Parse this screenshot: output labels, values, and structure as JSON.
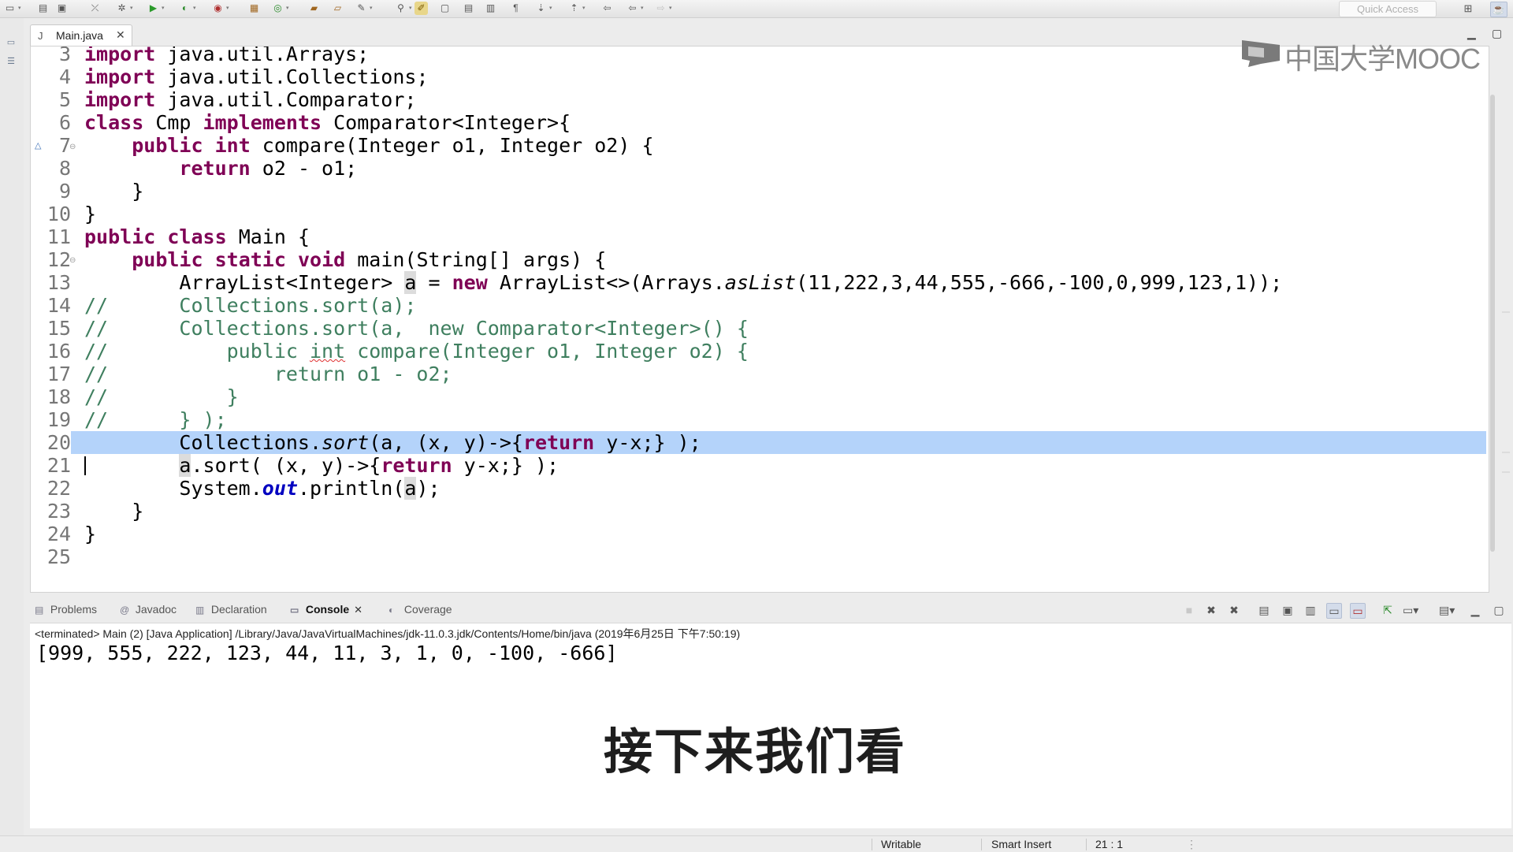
{
  "toolbar": {
    "icons": [
      "new-icon",
      "save-icon",
      "print-icon",
      "skip-breakpoints-icon",
      "debug-icon",
      "run-icon",
      "coverage-icon",
      "external-tools-icon",
      "new-java-project-icon",
      "new-package-icon",
      "new-class-icon",
      "open-type-icon",
      "open-task-icon",
      "search-icon",
      "toggle-mark-occurrences-icon",
      "highlight-icon",
      "block-selection-icon",
      "show-whitespace-icon",
      "next-annotation-icon",
      "prev-annotation-icon",
      "last-edit-icon",
      "back-icon",
      "forward-icon"
    ],
    "quick_access_placeholder": "Quick Access"
  },
  "editor": {
    "tab_label": "Main.java",
    "lines": [
      {
        "num": "3",
        "segments": [
          {
            "t": "import",
            "c": "kw"
          },
          {
            "t": " java.util.Arrays;"
          }
        ]
      },
      {
        "num": "4",
        "segments": [
          {
            "t": "import",
            "c": "kw"
          },
          {
            "t": " java.util.Collections;"
          }
        ]
      },
      {
        "num": "5",
        "segments": [
          {
            "t": "import",
            "c": "kw"
          },
          {
            "t": " java.util.Comparator;"
          }
        ]
      },
      {
        "num": "6",
        "segments": [
          {
            "t": "class",
            "c": "kw"
          },
          {
            "t": " Cmp "
          },
          {
            "t": "implements",
            "c": "kw"
          },
          {
            "t": " Comparator<Integer>{"
          }
        ]
      },
      {
        "num": "7",
        "segments": [
          {
            "t": "    "
          },
          {
            "t": "public",
            "c": "kw"
          },
          {
            "t": " "
          },
          {
            "t": "int",
            "c": "kw"
          },
          {
            "t": " compare(Integer o1, Integer o2) {"
          }
        ]
      },
      {
        "num": "8",
        "segments": [
          {
            "t": "        "
          },
          {
            "t": "return",
            "c": "kw"
          },
          {
            "t": " o2 - o1;"
          }
        ]
      },
      {
        "num": "9",
        "segments": [
          {
            "t": "    }"
          }
        ]
      },
      {
        "num": "10",
        "segments": [
          {
            "t": "}"
          }
        ]
      },
      {
        "num": "11",
        "segments": [
          {
            "t": "public",
            "c": "kw"
          },
          {
            "t": " "
          },
          {
            "t": "class",
            "c": "kw"
          },
          {
            "t": " Main {"
          }
        ]
      },
      {
        "num": "12",
        "segments": [
          {
            "t": "    "
          },
          {
            "t": "public",
            "c": "kw"
          },
          {
            "t": " "
          },
          {
            "t": "static",
            "c": "kw"
          },
          {
            "t": " "
          },
          {
            "t": "void",
            "c": "kw"
          },
          {
            "t": " main(String[] args) {"
          }
        ]
      },
      {
        "num": "13",
        "segments": [
          {
            "t": "        ArrayList<Integer> "
          },
          {
            "t": "a",
            "c": "occ"
          },
          {
            "t": " = "
          },
          {
            "t": "new",
            "c": "kw"
          },
          {
            "t": " ArrayList<>(Arrays."
          },
          {
            "t": "asList",
            "c": "it"
          },
          {
            "t": "(11,222,3,44,555,-666,-100,0,999,123,1));"
          }
        ]
      },
      {
        "num": "14",
        "segments": [
          {
            "t": "//      Collections.sort(a);",
            "c": "cm"
          }
        ]
      },
      {
        "num": "15",
        "segments": [
          {
            "t": "//      Collections.sort(a,  new Comparator<Integer>() {",
            "c": "cm"
          }
        ]
      },
      {
        "num": "16",
        "segments": [
          {
            "t": "//          public ",
            "c": "cm"
          },
          {
            "t": "int",
            "c": "cm squiggle"
          },
          {
            "t": " compare(Integer o1, Integer o2) {",
            "c": "cm"
          }
        ]
      },
      {
        "num": "17",
        "segments": [
          {
            "t": "//              return o1 - o2;",
            "c": "cm"
          }
        ]
      },
      {
        "num": "18",
        "segments": [
          {
            "t": "//          }",
            "c": "cm"
          }
        ]
      },
      {
        "num": "19",
        "segments": [
          {
            "t": "//      } );",
            "c": "cm"
          }
        ]
      },
      {
        "num": "20",
        "segments": [
          {
            "t": "        Collections."
          },
          {
            "t": "sort",
            "c": "it"
          },
          {
            "t": "(a, (x, y)->{"
          },
          {
            "t": "return",
            "c": "kw"
          },
          {
            "t": " y-x;} );"
          }
        ]
      },
      {
        "num": "21",
        "segments": [
          {
            "t": "        "
          },
          {
            "t": "a",
            "c": "occ"
          },
          {
            "t": ".sort( (x, y)->{"
          },
          {
            "t": "return",
            "c": "kw"
          },
          {
            "t": " y-x;} );"
          }
        ]
      },
      {
        "num": "22",
        "segments": [
          {
            "t": "        System."
          },
          {
            "t": "out",
            "c": "fld"
          },
          {
            "t": ".println("
          },
          {
            "t": "a",
            "c": "occ"
          },
          {
            "t": ");"
          }
        ]
      },
      {
        "num": "23",
        "segments": [
          {
            "t": "    }"
          }
        ]
      },
      {
        "num": "24",
        "segments": [
          {
            "t": "}"
          }
        ]
      },
      {
        "num": "25",
        "segments": []
      }
    ]
  },
  "watermark": {
    "text": "中国大学MOOC"
  },
  "console": {
    "tabs": [
      {
        "label": "Problems",
        "icon": "problems-icon"
      },
      {
        "label": "Javadoc",
        "icon": "at-icon"
      },
      {
        "label": "Declaration",
        "icon": "declaration-icon"
      },
      {
        "label": "Console",
        "icon": "console-icon",
        "active": true
      },
      {
        "label": "Coverage",
        "icon": "coverage-icon"
      }
    ],
    "header": "<terminated> Main (2) [Java Application] /Library/Java/JavaVirtualMachines/jdk-11.0.3.jdk/Contents/Home/bin/java (2019年6月25日 下午7:50:19)",
    "output": "[999, 555, 222, 123, 44, 11, 3, 1, 0, -100, -666]",
    "subtitle": "接下来我们看"
  },
  "status": {
    "writable": "Writable",
    "insert_mode": "Smart Insert",
    "position": "21 : 1"
  }
}
